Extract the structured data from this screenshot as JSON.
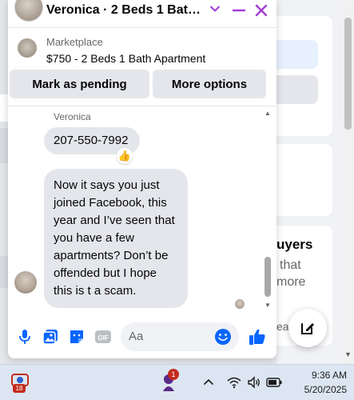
{
  "chat": {
    "title": "Veronica · 2 Beds 1 Bath A...",
    "listing": {
      "source": "Marketplace",
      "title": "$750 - 2 Beds 1 Bath Apartment"
    },
    "actions": {
      "mark_pending": "Mark as pending",
      "more_options": "More options"
    },
    "messages": {
      "sender": "Veronica",
      "phone": "207-550-7992",
      "reaction": "👍",
      "long_text": "Now it says you just joined Facebook, this year and I’ve seen that you have a few apartments? Don’t be offended but I hope this is t a scam."
    },
    "composer": {
      "placeholder": "Aa"
    }
  },
  "background": {
    "heading_fragment": "uyers",
    "line1_fragment": "that",
    "line2_fragment": "more",
    "link_fragment": "ear"
  },
  "taskbar": {
    "app_badge": "18",
    "pinned_badge": "1",
    "time": "9:36 AM",
    "date": "5/20/2025"
  },
  "colors": {
    "accent": "#0866ff",
    "header_icons": "#a33bd6",
    "bubble": "#e4e6eb",
    "button": "#e4e6eb",
    "badge": "#c42b1c"
  }
}
